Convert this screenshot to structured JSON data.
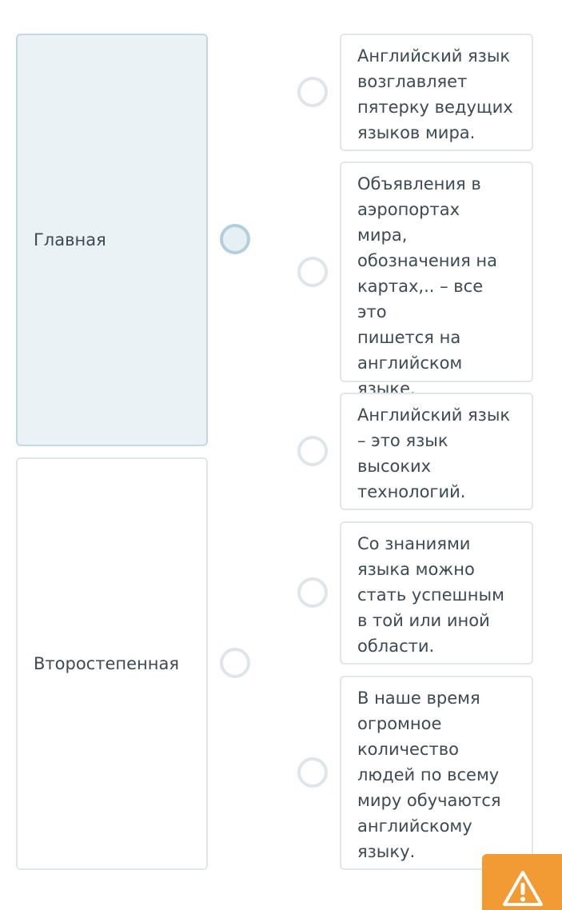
{
  "categories": [
    {
      "label": "Главная",
      "selected": true
    },
    {
      "label": "Второстепенная",
      "selected": false
    }
  ],
  "statements": [
    {
      "text": "Английский язык\nвозглавляет\nпятерку ведущих\nязыков мира."
    },
    {
      "text": "Объявления в\nаэропортах\nмира,\nобозначения на\nкартах,.. – все это\nпишется на\nанглийском\nязыке."
    },
    {
      "text": "Английский язык\n– это язык\nвысоких\nтехнологий."
    },
    {
      "text": "Со знаниями\nязыка можно\nстать успешным\nв той или иной\nобласти."
    },
    {
      "text": "В наше время\nогромное\nколичество\nлюдей по всему\nмиру обучаются\nанглийскому\nязыку."
    }
  ],
  "report_button": {
    "icon": "warning-icon",
    "color": "#f29a33"
  },
  "colors": {
    "selected_fill": "#eaf2f6",
    "border": "#e3e6e8",
    "text": "#3d4a52"
  }
}
